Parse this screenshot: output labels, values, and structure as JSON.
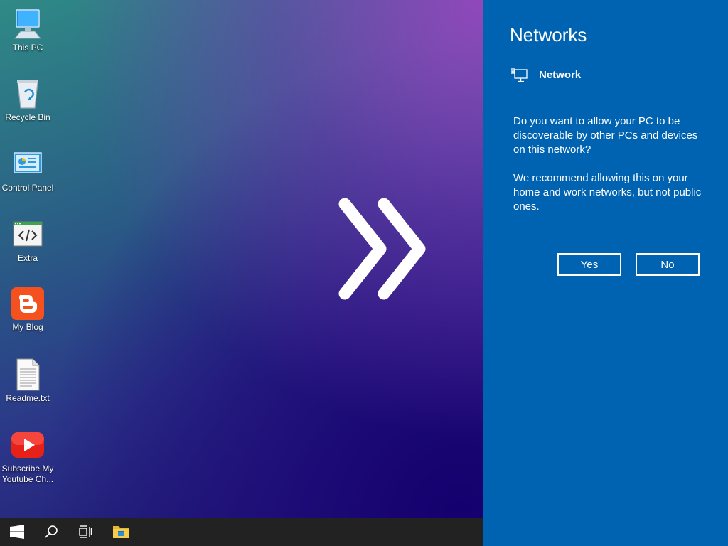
{
  "desktop": {
    "icons": [
      {
        "label": "This PC",
        "icon": "computer-icon"
      },
      {
        "label": "Recycle Bin",
        "icon": "recycle-bin-icon"
      },
      {
        "label": "Control Panel",
        "icon": "control-panel-icon"
      },
      {
        "label": "Extra",
        "icon": "code-window-icon"
      },
      {
        "label": "My Blog",
        "icon": "blogger-icon"
      },
      {
        "label": "Readme.txt",
        "icon": "text-file-icon"
      },
      {
        "label": "Subscribe My\nYoutube Ch...",
        "icon": "youtube-icon"
      }
    ]
  },
  "panel": {
    "title": "Networks",
    "network_name": "Network",
    "question": "Do you want to allow your PC to be discoverable by other PCs and devices on this network?",
    "recommendation": "We recommend allowing this on your home and work networks, but not public ones.",
    "yes_label": "Yes",
    "no_label": "No",
    "background_color": "#0063b1"
  },
  "taskbar": {
    "items": [
      {
        "icon": "windows-start-icon"
      },
      {
        "icon": "search-icon"
      },
      {
        "icon": "task-view-icon"
      },
      {
        "icon": "file-explorer-icon"
      }
    ],
    "background_color": "#222222"
  }
}
